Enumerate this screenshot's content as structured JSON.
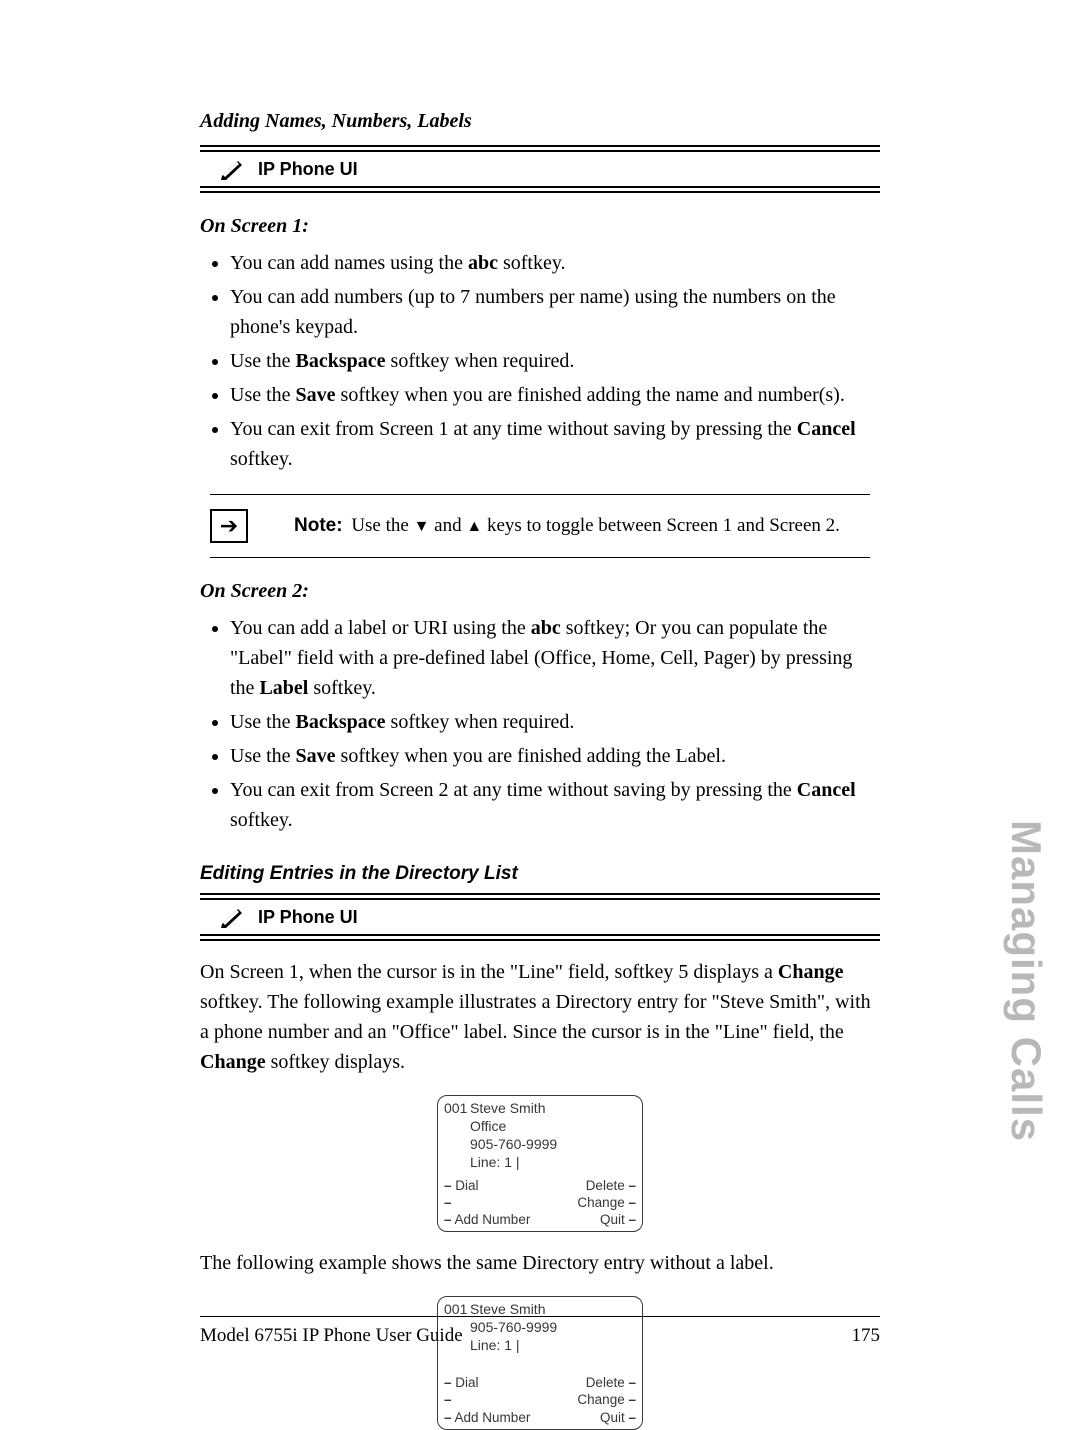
{
  "section_label": "Adding Names, Numbers, Labels",
  "ui_heading": "IP Phone UI",
  "screen1": {
    "heading": "On Screen 1:",
    "items": {
      "i0": {
        "pre": "You can add names using the ",
        "bold": "abc",
        "post": " softkey."
      },
      "i1": {
        "text": "You can add numbers (up to 7 numbers per name) using the numbers on the phone's keypad."
      },
      "i2": {
        "pre": "Use the ",
        "bold": "Backspace",
        "post": " softkey when required."
      },
      "i3": {
        "pre": "Use the ",
        "bold": "Save",
        "post": " softkey when you are finished adding the name and number(s)."
      },
      "i4": {
        "pre": "You can exit from Screen 1 at any time without saving by pressing the ",
        "bold": "Cancel",
        "post": " softkey."
      }
    }
  },
  "note": {
    "label": "Note:",
    "pre": " Use the ",
    "down": "▼",
    "mid": " and ",
    "up": "▲",
    "post": " keys to toggle between Screen 1 and Screen 2."
  },
  "screen2": {
    "heading": "On Screen 2:",
    "items": {
      "i0": {
        "pre": "You can add a label or URI using the ",
        "bold": "abc",
        "mid": " softkey; Or you can populate the \"Label\" field with a pre-defined label (Office, Home, Cell, Pager) by pressing the ",
        "bold2": "Label",
        "post": " softkey."
      },
      "i1": {
        "pre": "Use the ",
        "bold": "Backspace",
        "post": " softkey when required."
      },
      "i2": {
        "pre": "Use the ",
        "bold": "Save",
        "post": " softkey when you are finished adding the Label."
      },
      "i3": {
        "pre": "You can exit from Screen 2 at any time without saving by pressing the ",
        "bold": "Cancel",
        "post": " softkey."
      }
    }
  },
  "editing_heading": "Editing Entries in the Directory List",
  "para1": {
    "pre": "On Screen 1, when the cursor is in the \"Line\" field, softkey 5 displays a ",
    "bold1": "Change",
    "mid": " softkey. The following example illustrates a Directory entry for \"Steve Smith\", with a phone number and an \"Office\" label. Since the cursor is in the \"Line\" field, the ",
    "bold2": "Change",
    "post": " softkey displays."
  },
  "phone1": {
    "num": "001",
    "name": "Steve Smith",
    "label": "Office",
    "number": "905-760-9999",
    "line": "Line: 1 |",
    "sk_left": {
      "a": "Dial",
      "b": "",
      "c": "Add Number"
    },
    "sk_right": {
      "a": "Delete",
      "b": "Change",
      "c": "Quit"
    }
  },
  "para2": "The following example shows the same Directory entry without a label.",
  "phone2": {
    "num": "001",
    "name": "Steve Smith",
    "number": "905-760-9999",
    "line": "Line: 1 |",
    "sk_left": {
      "a": "Dial",
      "b": "",
      "c": "Add Number"
    },
    "sk_right": {
      "a": "Delete",
      "b": "Change",
      "c": "Quit"
    }
  },
  "side_tab": "Managing Calls",
  "footer": {
    "left": "Model 6755i IP Phone User Guide",
    "right": "175"
  }
}
